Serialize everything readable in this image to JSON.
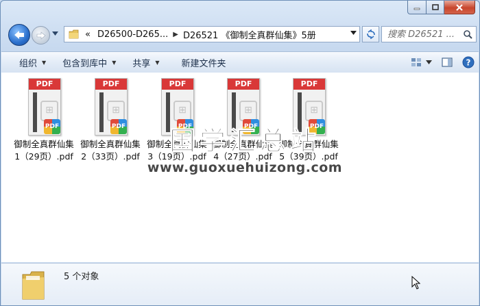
{
  "window": {
    "minimize_icon": "minimize-icon",
    "maximize_icon": "maximize-icon",
    "close_icon": "close-icon"
  },
  "nav": {
    "back_icon": "back-arrow-icon",
    "forward_icon": "forward-arrow-icon",
    "breadcrumb": {
      "overflow": "«",
      "parent": "D26500-D265...",
      "current": "D26521 《御制全真群仙集》5册"
    },
    "search_placeholder": "搜索 D26521 ..."
  },
  "toolbar": {
    "organize": "组织",
    "include_in_library": "包含到库中",
    "share": "共享",
    "new_folder": "新建文件夹"
  },
  "files": [
    {
      "line1": "御制全真群仙集",
      "line2": "1（29页）.pdf"
    },
    {
      "line1": "御制全真群仙集",
      "line2": "2（33页）.pdf"
    },
    {
      "line1": "御制全真群仙集",
      "line2": "3（19页）.pdf"
    },
    {
      "line1": "御制全真群仙集",
      "line2": "4（27页）.pdf"
    },
    {
      "line1": "御制全真群仙集",
      "line2": "5（39页）.pdf"
    }
  ],
  "file_icon": {
    "band": "PDF",
    "badge": "PDF"
  },
  "watermark": {
    "title": "国学汇总站",
    "url": "www.guoxuehuizong.com"
  },
  "details": {
    "count": "5 个对象"
  },
  "colors": {
    "accent": "#2a6fcc",
    "pdf_red": "#d93838",
    "close_red": "#c8452c"
  }
}
